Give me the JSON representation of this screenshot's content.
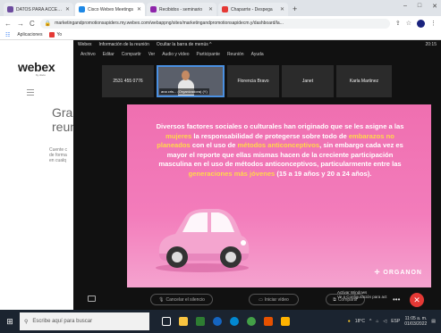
{
  "browser": {
    "tabs": [
      {
        "label": "DATOS PARA ACCESO",
        "color": "#6d4c9f",
        "active": false
      },
      {
        "label": "Cisco Webex Meetings",
        "color": "#1e88e5",
        "active": true
      },
      {
        "label": "Recibidos - seminario",
        "color": "#8e24aa",
        "active": false
      },
      {
        "label": "Chaparrte - Despega",
        "color": "#e53935",
        "active": false
      }
    ],
    "new_tab": "+",
    "window_controls": [
      "–",
      "□",
      "✕"
    ],
    "back": "←",
    "forward": "→",
    "reload": "C",
    "url": "marketingandpromotionsapiders.my.webex.com/webappng/sites/marketingandpromotionsapidecm.y/dashboard/la...",
    "bookmarks": [
      {
        "label": "Aplicaciones",
        "color": "#4285f4"
      },
      {
        "label": "Yo",
        "color": "#e53935"
      }
    ]
  },
  "left_page": {
    "logo": "webex",
    "logo_sub": "by cisco",
    "heading_line1": "Grac",
    "heading_line2": "reun",
    "body_lines": [
      "Cuente c",
      "de forma",
      "en cualq"
    ]
  },
  "meeting": {
    "title_items": [
      "Webex",
      "Información de la reunión",
      "Ocultar la barra de menús ^"
    ],
    "time": "20:15",
    "menu": [
      "Archivo",
      "Editar",
      "Compartir",
      "Ver",
      "Audio y vídeo",
      "Participante",
      "Reunión",
      "Ayuda"
    ],
    "participants": [
      {
        "name": "2531 455 0776",
        "video": false
      },
      {
        "name": "ana cris... (Organizadora) (Y)",
        "video": true
      },
      {
        "name": "Florencia Bravo",
        "video": false
      },
      {
        "name": "Janet",
        "video": false
      },
      {
        "name": "Karla Martinez",
        "video": false
      }
    ],
    "slide": {
      "segments": [
        {
          "text": "Diversos factores sociales o culturales han originado que se les asigne a las ",
          "hl": false
        },
        {
          "text": "mujeres",
          "hl": true
        },
        {
          "text": " la responsabilidad de protegerse sobre todo de ",
          "hl": false
        },
        {
          "text": "embarazos no planeados",
          "hl": true
        },
        {
          "text": " con el uso de ",
          "hl": false
        },
        {
          "text": "métodos anticonceptivos",
          "hl": true
        },
        {
          "text": ", sin embargo cada vez es mayor el reporte que ellas mismas hacen de la creciente participación masculina en el uso de métodos anticonceptivos, particularmente entre las ",
          "hl": false
        },
        {
          "text": "generaciones más jóvenes",
          "hl": true
        },
        {
          "text": " (15 a 19 años y 20 a 24 años).",
          "hl": false
        }
      ],
      "watermark": "✢ ORGANON",
      "highlight_color": "#ffd84a"
    },
    "controls": {
      "mute": "Cancelar el silencio",
      "video": "Iniciar vídeo",
      "share": "Compartir",
      "activate_line1": "Activar Windows",
      "activate_line2": "Ve a Configuración para act",
      "end": "✕"
    }
  },
  "taskbar": {
    "search_placeholder": "Escribe aquí para buscar",
    "weather": "18°C",
    "lang": "ESP",
    "time": "11:05 a. m.",
    "date": "01/03/2022",
    "app_colors": [
      "#ffffff",
      "#ffffff",
      "#2e7d32",
      "#1565c0",
      "#0288d1",
      "#43a047",
      "#e65100",
      "#ffb300"
    ]
  }
}
